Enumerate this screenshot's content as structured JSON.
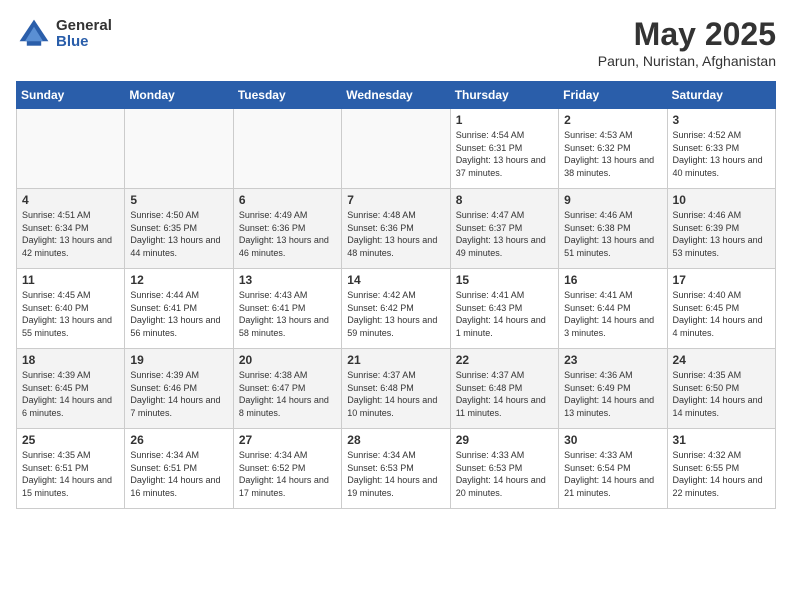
{
  "logo": {
    "general": "General",
    "blue": "Blue"
  },
  "title": "May 2025",
  "subtitle": "Parun, Nuristan, Afghanistan",
  "days_header": [
    "Sunday",
    "Monday",
    "Tuesday",
    "Wednesday",
    "Thursday",
    "Friday",
    "Saturday"
  ],
  "weeks": [
    [
      {
        "day": "",
        "detail": ""
      },
      {
        "day": "",
        "detail": ""
      },
      {
        "day": "",
        "detail": ""
      },
      {
        "day": "",
        "detail": ""
      },
      {
        "day": "1",
        "detail": "Sunrise: 4:54 AM\nSunset: 6:31 PM\nDaylight: 13 hours\nand 37 minutes."
      },
      {
        "day": "2",
        "detail": "Sunrise: 4:53 AM\nSunset: 6:32 PM\nDaylight: 13 hours\nand 38 minutes."
      },
      {
        "day": "3",
        "detail": "Sunrise: 4:52 AM\nSunset: 6:33 PM\nDaylight: 13 hours\nand 40 minutes."
      }
    ],
    [
      {
        "day": "4",
        "detail": "Sunrise: 4:51 AM\nSunset: 6:34 PM\nDaylight: 13 hours\nand 42 minutes."
      },
      {
        "day": "5",
        "detail": "Sunrise: 4:50 AM\nSunset: 6:35 PM\nDaylight: 13 hours\nand 44 minutes."
      },
      {
        "day": "6",
        "detail": "Sunrise: 4:49 AM\nSunset: 6:36 PM\nDaylight: 13 hours\nand 46 minutes."
      },
      {
        "day": "7",
        "detail": "Sunrise: 4:48 AM\nSunset: 6:36 PM\nDaylight: 13 hours\nand 48 minutes."
      },
      {
        "day": "8",
        "detail": "Sunrise: 4:47 AM\nSunset: 6:37 PM\nDaylight: 13 hours\nand 49 minutes."
      },
      {
        "day": "9",
        "detail": "Sunrise: 4:46 AM\nSunset: 6:38 PM\nDaylight: 13 hours\nand 51 minutes."
      },
      {
        "day": "10",
        "detail": "Sunrise: 4:46 AM\nSunset: 6:39 PM\nDaylight: 13 hours\nand 53 minutes."
      }
    ],
    [
      {
        "day": "11",
        "detail": "Sunrise: 4:45 AM\nSunset: 6:40 PM\nDaylight: 13 hours\nand 55 minutes."
      },
      {
        "day": "12",
        "detail": "Sunrise: 4:44 AM\nSunset: 6:41 PM\nDaylight: 13 hours\nand 56 minutes."
      },
      {
        "day": "13",
        "detail": "Sunrise: 4:43 AM\nSunset: 6:41 PM\nDaylight: 13 hours\nand 58 minutes."
      },
      {
        "day": "14",
        "detail": "Sunrise: 4:42 AM\nSunset: 6:42 PM\nDaylight: 13 hours\nand 59 minutes."
      },
      {
        "day": "15",
        "detail": "Sunrise: 4:41 AM\nSunset: 6:43 PM\nDaylight: 14 hours\nand 1 minute."
      },
      {
        "day": "16",
        "detail": "Sunrise: 4:41 AM\nSunset: 6:44 PM\nDaylight: 14 hours\nand 3 minutes."
      },
      {
        "day": "17",
        "detail": "Sunrise: 4:40 AM\nSunset: 6:45 PM\nDaylight: 14 hours\nand 4 minutes."
      }
    ],
    [
      {
        "day": "18",
        "detail": "Sunrise: 4:39 AM\nSunset: 6:45 PM\nDaylight: 14 hours\nand 6 minutes."
      },
      {
        "day": "19",
        "detail": "Sunrise: 4:39 AM\nSunset: 6:46 PM\nDaylight: 14 hours\nand 7 minutes."
      },
      {
        "day": "20",
        "detail": "Sunrise: 4:38 AM\nSunset: 6:47 PM\nDaylight: 14 hours\nand 8 minutes."
      },
      {
        "day": "21",
        "detail": "Sunrise: 4:37 AM\nSunset: 6:48 PM\nDaylight: 14 hours\nand 10 minutes."
      },
      {
        "day": "22",
        "detail": "Sunrise: 4:37 AM\nSunset: 6:48 PM\nDaylight: 14 hours\nand 11 minutes."
      },
      {
        "day": "23",
        "detail": "Sunrise: 4:36 AM\nSunset: 6:49 PM\nDaylight: 14 hours\nand 13 minutes."
      },
      {
        "day": "24",
        "detail": "Sunrise: 4:35 AM\nSunset: 6:50 PM\nDaylight: 14 hours\nand 14 minutes."
      }
    ],
    [
      {
        "day": "25",
        "detail": "Sunrise: 4:35 AM\nSunset: 6:51 PM\nDaylight: 14 hours\nand 15 minutes."
      },
      {
        "day": "26",
        "detail": "Sunrise: 4:34 AM\nSunset: 6:51 PM\nDaylight: 14 hours\nand 16 minutes."
      },
      {
        "day": "27",
        "detail": "Sunrise: 4:34 AM\nSunset: 6:52 PM\nDaylight: 14 hours\nand 17 minutes."
      },
      {
        "day": "28",
        "detail": "Sunrise: 4:34 AM\nSunset: 6:53 PM\nDaylight: 14 hours\nand 19 minutes."
      },
      {
        "day": "29",
        "detail": "Sunrise: 4:33 AM\nSunset: 6:53 PM\nDaylight: 14 hours\nand 20 minutes."
      },
      {
        "day": "30",
        "detail": "Sunrise: 4:33 AM\nSunset: 6:54 PM\nDaylight: 14 hours\nand 21 minutes."
      },
      {
        "day": "31",
        "detail": "Sunrise: 4:32 AM\nSunset: 6:55 PM\nDaylight: 14 hours\nand 22 minutes."
      }
    ]
  ],
  "alt_rows": [
    1,
    3
  ]
}
